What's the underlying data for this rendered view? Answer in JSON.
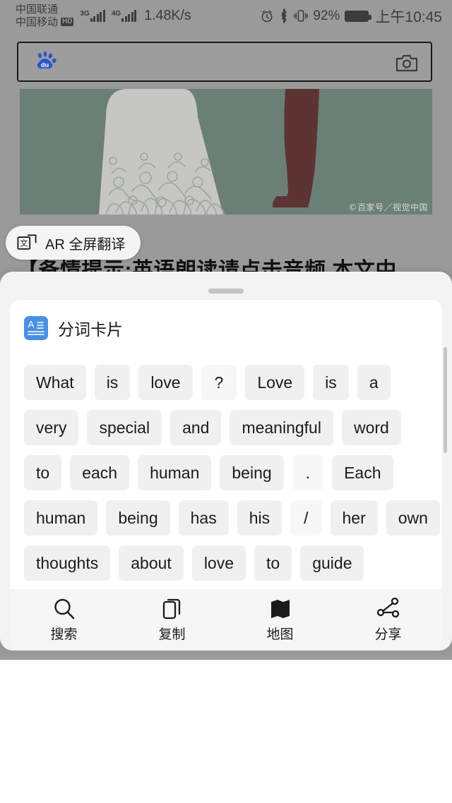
{
  "status_bar": {
    "carrier_primary": "中国联通",
    "carrier_secondary": "中国移动",
    "hd_badge": "HD",
    "network_1": "3G",
    "network_2": "4G",
    "net_speed": "1.48K/s",
    "battery_percent": "92%",
    "clock": "上午10:45",
    "icons": [
      "alarm-icon",
      "bluetooth-icon",
      "vibrate-icon",
      "battery-icon"
    ]
  },
  "search_bar": {
    "logo_text": "du",
    "logo_name": "baidu-paw-logo",
    "camera_icon": "camera-icon",
    "query": ""
  },
  "picture": {
    "watermark": "©百家号／视觉中国",
    "background_color": "#6c7f77"
  },
  "ar_chip": {
    "label": "AR 全屏翻译",
    "icon": "translate-icon"
  },
  "article": {
    "obscured_line": "【备情提示:英语朗读请点击音频,本文中"
  },
  "sheet": {
    "handle": "drag-handle",
    "card": {
      "icon": "word-card-icon",
      "icon_color": "#4a90e2",
      "title": "分词卡片",
      "rows": [
        [
          "What",
          "is",
          "love",
          "?",
          "Love",
          "is",
          "a"
        ],
        [
          "very",
          "special",
          "and",
          "meaningful",
          "word"
        ],
        [
          "to",
          "each",
          "human",
          "being",
          ".",
          "Each"
        ],
        [
          "human",
          "being",
          "has",
          "his",
          "/",
          "her",
          "own"
        ],
        [
          "thoughts",
          "about",
          "love",
          "to",
          "guide"
        ]
      ],
      "punctuation": [
        "?",
        ".",
        "/"
      ]
    },
    "actions": [
      {
        "label": "搜索",
        "icon": "search-icon"
      },
      {
        "label": "复制",
        "icon": "copy-icon"
      },
      {
        "label": "地图",
        "icon": "map-icon"
      },
      {
        "label": "分享",
        "icon": "share-icon"
      }
    ]
  }
}
